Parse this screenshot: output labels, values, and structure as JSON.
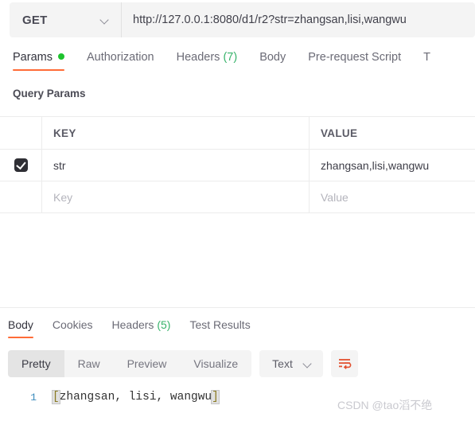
{
  "request": {
    "method": "GET",
    "method_caret": "chevron-down-icon",
    "url": "http://127.0.0.1:8080/d1/r2?str=zhangsan,lisi,wangwu",
    "url_placeholder": "Enter request URL",
    "tabs": [
      {
        "label": "Params",
        "badge": "",
        "dot": true,
        "active": true
      },
      {
        "label": "Authorization",
        "badge": "",
        "dot": false,
        "active": false
      },
      {
        "label": "Headers",
        "badge": "(7)",
        "dot": false,
        "active": false
      },
      {
        "label": "Body",
        "badge": "",
        "dot": false,
        "active": false
      },
      {
        "label": "Pre-request Script",
        "badge": "",
        "dot": false,
        "active": false
      },
      {
        "label": "T",
        "badge": "",
        "dot": false,
        "active": false
      }
    ]
  },
  "params": {
    "section_title": "Query Params",
    "columns": {
      "key": "KEY",
      "value": "VALUE"
    },
    "rows": [
      {
        "checked": true,
        "key": "str",
        "value": "zhangsan,lisi,wangwu"
      }
    ],
    "new_row": {
      "key_placeholder": "Key",
      "value_placeholder": "Value"
    }
  },
  "response": {
    "tabs": [
      {
        "label": "Body",
        "badge": "",
        "active": true
      },
      {
        "label": "Cookies",
        "badge": "",
        "active": false
      },
      {
        "label": "Headers",
        "badge": "(5)",
        "active": false
      },
      {
        "label": "Test Results",
        "badge": "",
        "active": false
      }
    ],
    "view_modes": [
      {
        "label": "Pretty",
        "active": true
      },
      {
        "label": "Raw",
        "active": false
      },
      {
        "label": "Preview",
        "active": false
      },
      {
        "label": "Visualize",
        "active": false
      }
    ],
    "format": "Text",
    "format_caret": "chevron-down-icon",
    "wrap_icon": "word-wrap-icon",
    "body": {
      "line_number": "1",
      "open_bracket": "[",
      "content": "zhangsan, lisi, wangwu",
      "close_bracket": "]"
    }
  },
  "watermark": "CSDN @tao滔不绝",
  "colors": {
    "accent": "#ff6c37",
    "green_dot": "#1ec32e",
    "badge_green": "#38b36b",
    "panel_bg": "#f4f4f4",
    "border": "#ececec"
  }
}
